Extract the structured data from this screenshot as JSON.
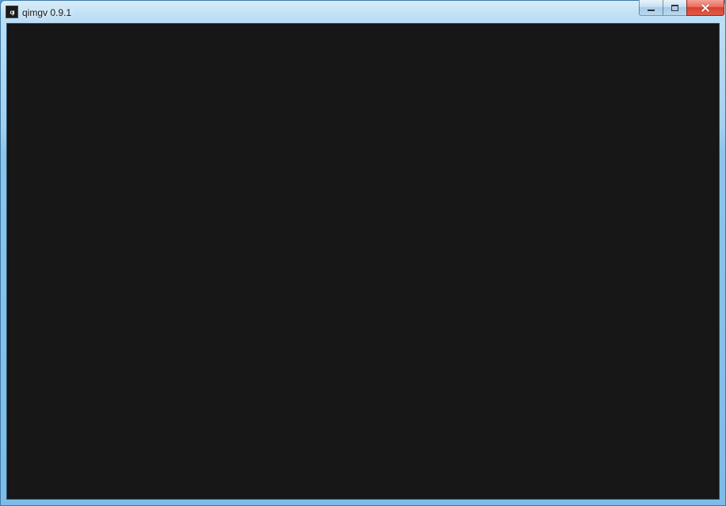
{
  "window": {
    "title": "qimgv 0.9.1",
    "app_icon_text": "qı"
  },
  "controls": {
    "minimize_name": "minimize-button",
    "maximize_name": "maximize-button",
    "close_name": "close-button"
  }
}
